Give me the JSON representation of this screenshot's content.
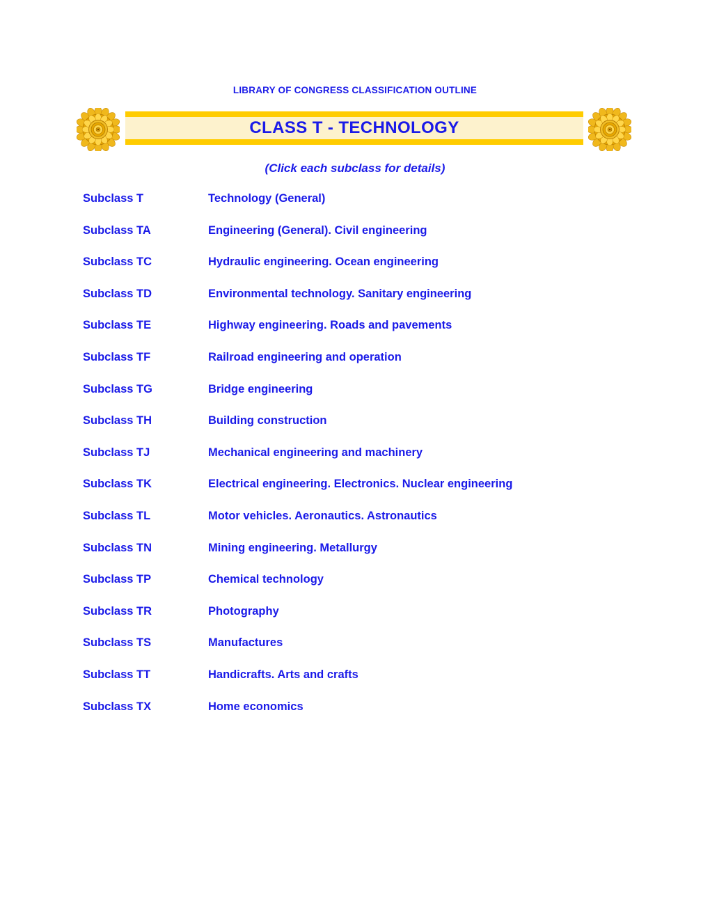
{
  "header": {
    "eyebrow": "LIBRARY OF CONGRESS CLASSIFICATION OUTLINE",
    "banner_title": "CLASS T - TECHNOLOGY",
    "subtitle": "(Click each subclass for details)"
  },
  "colors": {
    "link_blue": "#1a1ae8",
    "banner_bar": "#ffcc00",
    "banner_fill": "#fdf2cd",
    "rosette_gold": "#e8a800",
    "rosette_light": "#ffd633",
    "page_background": "#ffffff"
  },
  "ornaments": {
    "left": "rosette-ornament",
    "right": "rosette-ornament"
  },
  "subclasses": [
    {
      "code": "Subclass T",
      "title": "Technology (General)"
    },
    {
      "code": "Subclass TA",
      "title": "Engineering (General).  Civil engineering"
    },
    {
      "code": "Subclass TC",
      "title": "Hydraulic engineering.  Ocean engineering"
    },
    {
      "code": "Subclass TD",
      "title": "Environmental technology.  Sanitary engineering"
    },
    {
      "code": "Subclass TE",
      "title": "Highway engineering.  Roads and pavements"
    },
    {
      "code": "Subclass TF",
      "title": "Railroad engineering and operation"
    },
    {
      "code": "Subclass TG",
      "title": "Bridge engineering"
    },
    {
      "code": "Subclass TH",
      "title": "Building construction"
    },
    {
      "code": "Subclass TJ",
      "title": "Mechanical engineering and machinery"
    },
    {
      "code": "Subclass TK",
      "title": "Electrical engineering.  Electronics.  Nuclear engineering"
    },
    {
      "code": "Subclass TL",
      "title": "Motor vehicles.  Aeronautics.  Astronautics"
    },
    {
      "code": "Subclass TN",
      "title": "Mining engineering.  Metallurgy"
    },
    {
      "code": "Subclass TP",
      "title": "Chemical technology"
    },
    {
      "code": "Subclass TR",
      "title": "Photography"
    },
    {
      "code": "Subclass TS",
      "title": "Manufactures"
    },
    {
      "code": "Subclass TT",
      "title": "Handicrafts.  Arts and crafts"
    },
    {
      "code": "Subclass TX",
      "title": "Home economics"
    }
  ]
}
